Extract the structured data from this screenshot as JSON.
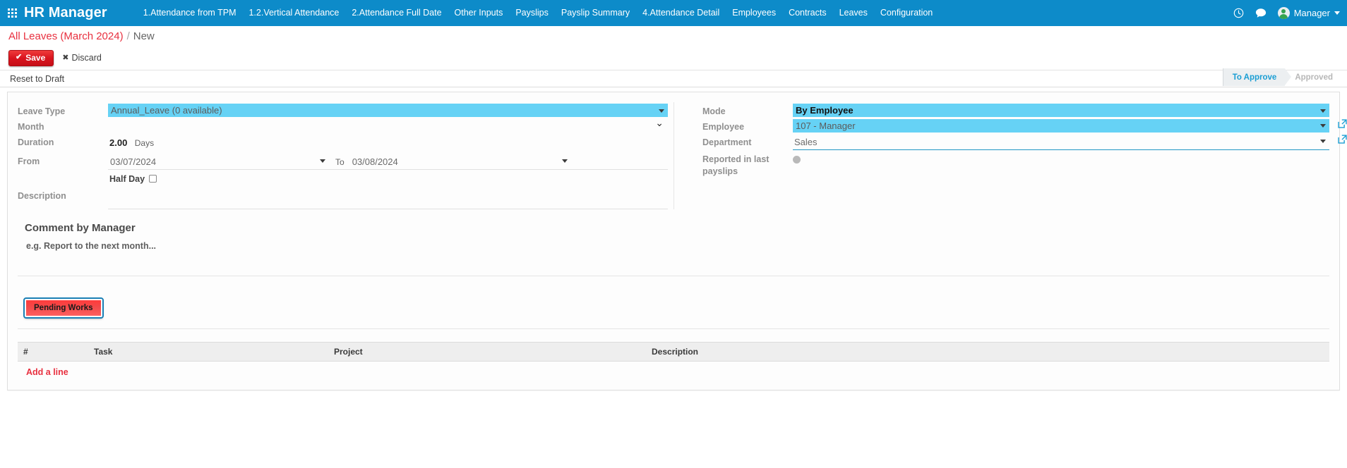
{
  "navbar": {
    "apps_icon": "apps-grid-icon",
    "brand": "HR Manager",
    "menu": [
      {
        "label": "1.Attendance from TPM"
      },
      {
        "label": "1.2.Vertical Attendance"
      },
      {
        "label": "2.Attendance Full Date"
      },
      {
        "label": "Other Inputs"
      },
      {
        "label": "Payslips"
      },
      {
        "label": "Payslip Summary"
      },
      {
        "label": "4.Attendance Detail"
      },
      {
        "label": "Employees"
      },
      {
        "label": "Contracts"
      },
      {
        "label": "Leaves"
      },
      {
        "label": "Configuration"
      }
    ],
    "right": {
      "clock_icon": "clock-icon",
      "messages_icon": "chat-bubble-icon",
      "user_name": "Manager"
    },
    "background": "#0d8bc9"
  },
  "breadcrumb": {
    "parent": "All Leaves (March 2024)",
    "separator": "/",
    "current": "New",
    "parent_color": "#e8303f"
  },
  "action_bar": {
    "save_label": "Save",
    "save_icon": "check-icon",
    "discard_label": "Discard",
    "discard_icon": "close-icon"
  },
  "status_bar": {
    "reset_to_draft": "Reset to Draft",
    "stages": [
      {
        "label": "To Approve",
        "active": true
      },
      {
        "label": "Approved",
        "active": false
      }
    ],
    "active_color": "#1a9ed4"
  },
  "form": {
    "left": {
      "leave_type": {
        "label": "Leave Type",
        "value": "Annual_Leave (0 available)"
      },
      "month": {
        "label": "Month",
        "value": ""
      },
      "duration": {
        "label": "Duration",
        "value": "2.00",
        "unit": "Days"
      },
      "from": {
        "label": "From",
        "value": "03/07/2024",
        "to_label": "To",
        "to_value": "03/08/2024"
      },
      "half_day": {
        "label": "Half Day",
        "checked": false
      },
      "description": {
        "label": "Description",
        "value": ""
      }
    },
    "right": {
      "mode": {
        "label": "Mode",
        "value": "By Employee"
      },
      "employee": {
        "label": "Employee",
        "value": "107 - Manager",
        "ext_icon": "external-link-icon"
      },
      "department": {
        "label": "Department",
        "value": "Sales",
        "ext_icon": "external-link-icon"
      },
      "reported_in_last_payslips": {
        "label": "Reported in last payslips",
        "value": ""
      }
    },
    "highlight_color": "#66d2f5"
  },
  "comment_section": {
    "title": "Comment by Manager",
    "placeholder": "e.g. Report to the next month..."
  },
  "pending_works": {
    "label": "Pending Works"
  },
  "lines_table": {
    "columns": [
      "#",
      "Task",
      "Project",
      "Description"
    ],
    "rows": [],
    "add_line_label": "Add a line"
  }
}
